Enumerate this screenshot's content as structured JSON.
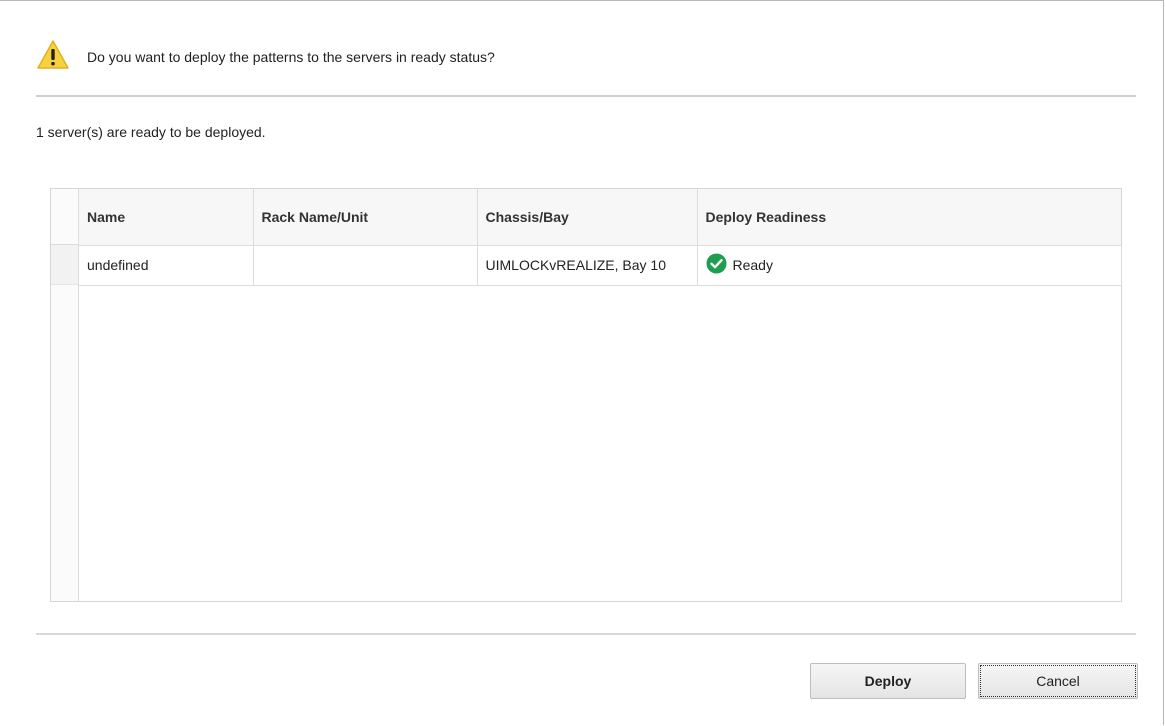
{
  "dialog": {
    "question": "Do you want to deploy the patterns to the servers in ready status?",
    "ready_count_text": "1 server(s) are ready to be deployed.",
    "icons": {
      "warning": "warning-icon",
      "status_ok": "check-circle-icon"
    },
    "colors": {
      "warning_fill": "#f7d23e",
      "ok_green": "#1f9e4f"
    }
  },
  "table": {
    "columns": [
      "Name",
      "Rack Name/Unit",
      "Chassis/Bay",
      "Deploy Readiness"
    ],
    "rows": [
      {
        "name": "undefined",
        "rack": "",
        "chassis": "UIMLOCKvREALIZE, Bay 10",
        "readiness": "Ready"
      }
    ]
  },
  "buttons": {
    "deploy": "Deploy",
    "cancel": "Cancel"
  }
}
